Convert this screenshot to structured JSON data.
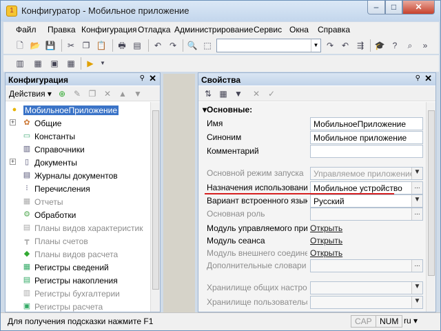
{
  "window": {
    "title": "Конфигуратор - Мобильное приложение",
    "min": "–",
    "max": "□",
    "close": "✕"
  },
  "menu": [
    "Файл",
    "Правка",
    "Конфигурация",
    "Отладка",
    "Администрирование",
    "Сервис",
    "Окна",
    "Справка"
  ],
  "toolbar": {
    "search_value": ""
  },
  "config_panel": {
    "title": "Конфигурация",
    "actions_label": "Действия",
    "items": [
      {
        "label": "МобильноеПриложение",
        "icon": "config-root-icon",
        "selected": true
      },
      {
        "label": "Общие",
        "icon": "common-icon",
        "expandable": true
      },
      {
        "label": "Константы",
        "icon": "constants-icon"
      },
      {
        "label": "Справочники",
        "icon": "catalogs-icon"
      },
      {
        "label": "Документы",
        "icon": "documents-icon",
        "expandable": true
      },
      {
        "label": "Журналы документов",
        "icon": "journals-icon"
      },
      {
        "label": "Перечисления",
        "icon": "enums-icon"
      },
      {
        "label": "Отчеты",
        "icon": "reports-icon",
        "disabled": true
      },
      {
        "label": "Обработки",
        "icon": "processing-icon"
      },
      {
        "label": "Планы видов характеристик",
        "icon": "chart-of-characteristics-icon",
        "disabled": true
      },
      {
        "label": "Планы счетов",
        "icon": "chart-of-accounts-icon",
        "disabled": true
      },
      {
        "label": "Планы видов расчета",
        "icon": "chart-of-calc-icon",
        "disabled": true
      },
      {
        "label": "Регистры сведений",
        "icon": "info-registers-icon"
      },
      {
        "label": "Регистры накопления",
        "icon": "accum-registers-icon"
      },
      {
        "label": "Регистры бухгалтерии",
        "icon": "accounting-registers-icon",
        "disabled": true
      },
      {
        "label": "Регистры расчета",
        "icon": "calc-registers-icon",
        "disabled": true
      }
    ]
  },
  "props_panel": {
    "title": "Свойства",
    "section": "Основные:",
    "rows": [
      {
        "label": "Имя",
        "value": "МобильноеПриложение",
        "type": "input"
      },
      {
        "label": "Синоним",
        "value": "Мобильное приложение",
        "type": "input"
      },
      {
        "label": "Комментарий",
        "value": "",
        "type": "input"
      },
      {
        "label": "Основной режим запуска",
        "value": "Управляемое приложение",
        "type": "select",
        "disabled": true
      },
      {
        "label": "Назначения использования",
        "value": "Мобильное устройство",
        "type": "ellipsis"
      },
      {
        "label": "Вариант встроенного языка",
        "value": "Русский",
        "type": "select"
      },
      {
        "label": "Основная роль",
        "value": "",
        "type": "ellipsis",
        "disabled": true
      },
      {
        "label": "Модуль управляемого прило",
        "value": "Открыть",
        "type": "link"
      },
      {
        "label": "Модуль сеанса",
        "value": "Открыть",
        "type": "link"
      },
      {
        "label": "Модуль внешнего соединени",
        "value": "Открыть",
        "type": "link",
        "disabled": true
      },
      {
        "label": "Дополнительные словари по",
        "value": "",
        "type": "ellipsis",
        "disabled": true
      },
      {
        "label": "Хранилище общих настроек",
        "value": "",
        "type": "select",
        "disabled": true
      },
      {
        "label": "Хранилище пользовательски",
        "value": "",
        "type": "select",
        "disabled": true
      }
    ]
  },
  "status": {
    "hint": "Для получения подсказки нажмите F1",
    "cap": "CAP",
    "num": "NUM",
    "lang": "ru"
  }
}
